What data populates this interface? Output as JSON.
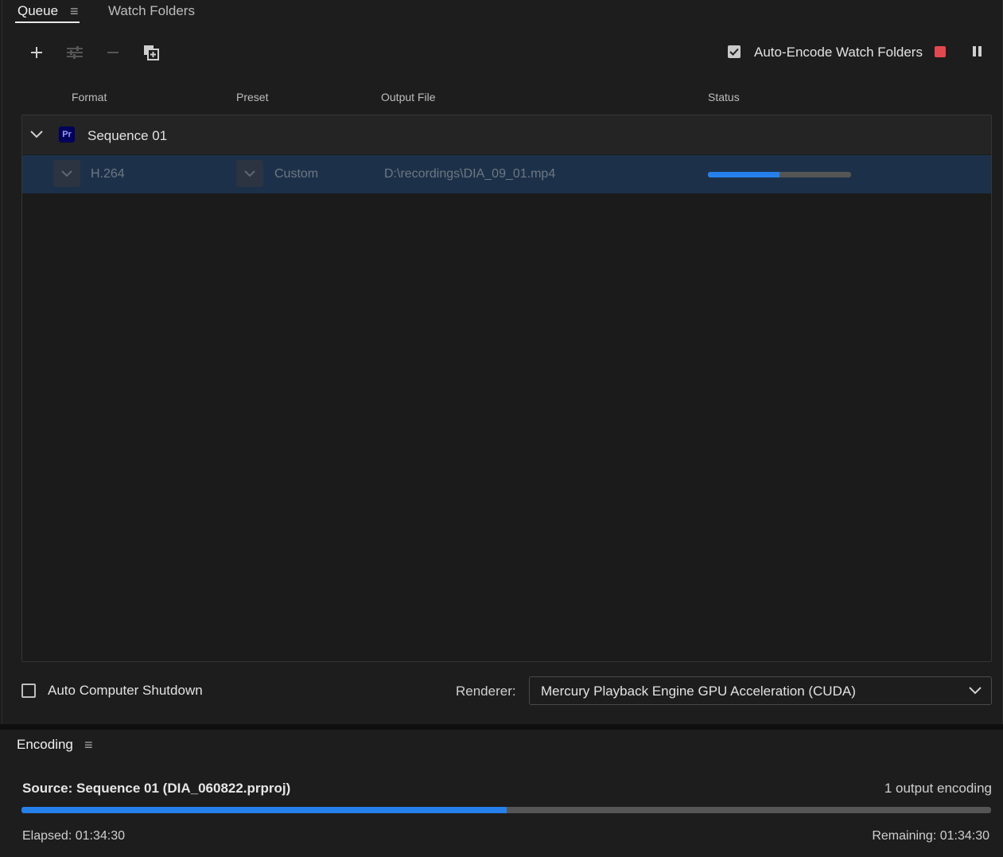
{
  "tabs": {
    "queue": "Queue",
    "watch_folders": "Watch Folders"
  },
  "toolbar": {
    "auto_encode_label": "Auto-Encode Watch Folders",
    "auto_encode_checked": true
  },
  "columns": {
    "format": "Format",
    "preset": "Preset",
    "output_file": "Output File",
    "status": "Status"
  },
  "queue": {
    "group": {
      "badge": "Pr",
      "name": "Sequence 01"
    },
    "item": {
      "format": "H.264",
      "preset": "Custom",
      "output_file": "D:\\recordings\\DIA_09_01.mp4",
      "progress": 0.5
    }
  },
  "footer": {
    "shutdown_label": "Auto Computer Shutdown",
    "shutdown_checked": false,
    "renderer_label": "Renderer:",
    "renderer_value": "Mercury Playback Engine GPU Acceleration (CUDA)"
  },
  "encoding": {
    "title": "Encoding",
    "source": "Source: Sequence 01 (DIA_060822.prproj)",
    "outputs": "1 output encoding",
    "progress": 0.5,
    "elapsed": "Elapsed: 01:34:30",
    "remaining": "Remaining: 01:34:30"
  },
  "colors": {
    "accent": "#2680eb",
    "stop": "#e34850",
    "selected_row": "#1c3149",
    "premiere_badge": "#00005b"
  }
}
